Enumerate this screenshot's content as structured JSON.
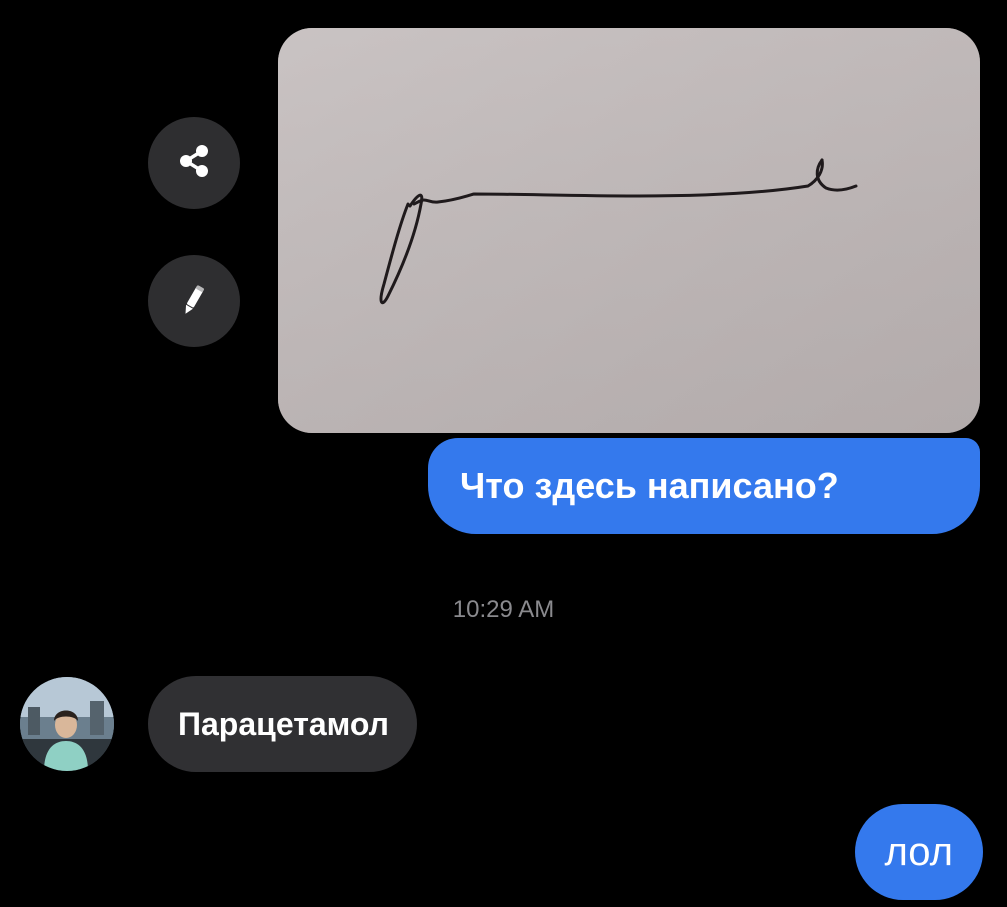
{
  "conversation": {
    "sent_question": "Что здесь написано?",
    "timestamp": "10:29 AM",
    "received_reply": "Парацетамол",
    "sent_reply": "лол"
  },
  "icons": {
    "share": "share-icon",
    "edit": "pencil-icon",
    "avatar": "contact-avatar"
  },
  "colors": {
    "background": "#000000",
    "sent_bubble": "#3479ed",
    "received_bubble": "#303033",
    "action_button": "#2e2e30",
    "timestamp_text": "#8a8a8e",
    "photo_paper": "#c1baba"
  }
}
